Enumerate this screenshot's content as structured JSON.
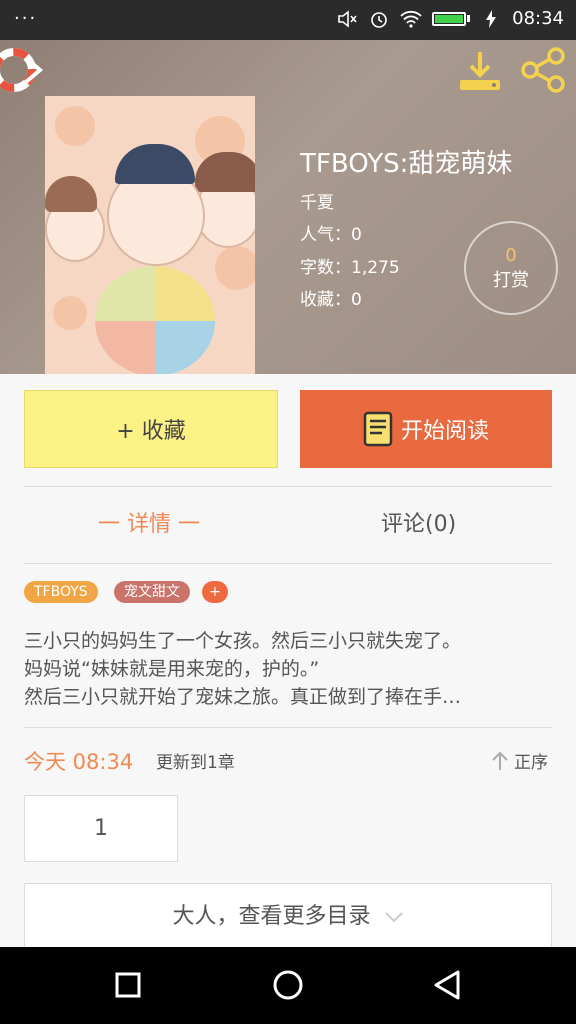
{
  "status": {
    "dots": "···",
    "time": "08:34",
    "icons": [
      "mute-icon",
      "alarm-icon",
      "wifi-icon",
      "battery-icon",
      "charging-icon"
    ]
  },
  "book": {
    "title": "TFBOYS:甜宠萌妹",
    "author": "千夏",
    "popularity": "人气：0",
    "words": "字数：1,275",
    "favorites": "收藏：0"
  },
  "tip": {
    "count": "0",
    "label": "打赏"
  },
  "actions": {
    "favorite": "+  收藏",
    "read": "开始阅读"
  },
  "tabs": {
    "detail": "一  详情  一",
    "comment": "评论(0)"
  },
  "tags": [
    "TFBOYS",
    "宠文甜文"
  ],
  "tag_add": "+",
  "synopsis": [
    "三小只的妈妈生了一个女孩。然后三小只就失宠了。",
    "妈妈说“妹妹就是用来宠的，护的。”",
    "然后三小只就开始了宠妹之旅。真正做到了捧在手…"
  ],
  "update": {
    "date": "今天 08:34",
    "text": "更新到1章",
    "sort": "正序"
  },
  "chapter_number": "1",
  "more_catalog": "大人，查看更多目录",
  "colors": {
    "accent": "#e96a3f",
    "favorite_bg": "#fcf185",
    "tab_active": "#ef8a55",
    "tag1": "#f1a645",
    "tag2": "#c9736b"
  }
}
